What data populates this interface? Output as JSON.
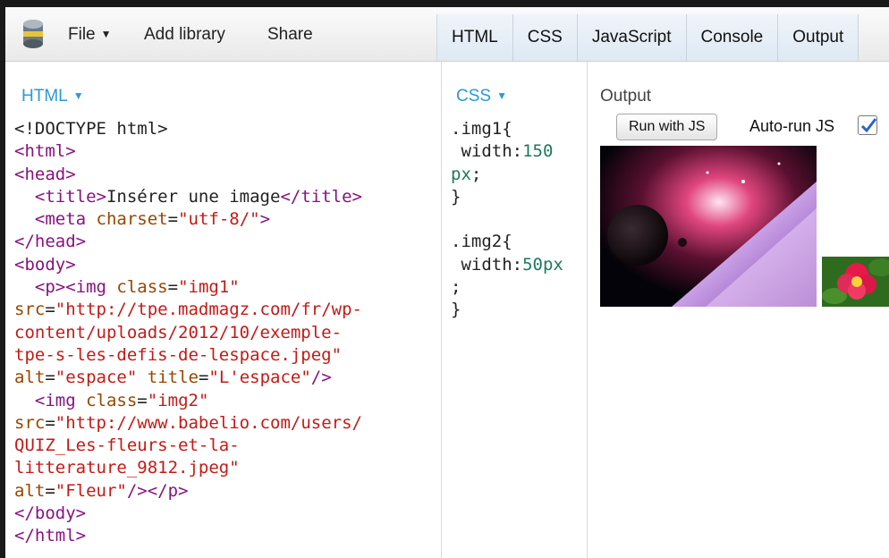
{
  "toolbar": {
    "logo_icon": "database-icon",
    "file_label": "File",
    "add_library_label": "Add library",
    "share_label": "Share",
    "tabs": [
      "HTML",
      "CSS",
      "JavaScript",
      "Console",
      "Output"
    ]
  },
  "html_panel": {
    "title": "HTML",
    "lines": [
      [
        [
          "p",
          "<!DOCTYPE html>"
        ]
      ],
      [
        [
          "t",
          "<html>"
        ]
      ],
      [
        [
          "t",
          "<head>"
        ]
      ],
      [
        [
          "p",
          "  "
        ],
        [
          "t",
          "<title>"
        ],
        [
          "p",
          "Insérer une image"
        ],
        [
          "t",
          "</title>"
        ]
      ],
      [
        [
          "p",
          "  "
        ],
        [
          "t",
          "<meta "
        ],
        [
          "a",
          "charset"
        ],
        [
          "p",
          "="
        ],
        [
          "v",
          "\"utf-8/\""
        ],
        [
          "t",
          ">"
        ]
      ],
      [
        [
          "t",
          "</head>"
        ]
      ],
      [
        [
          "t",
          "<body>"
        ]
      ],
      [
        [
          "p",
          "  "
        ],
        [
          "t",
          "<p><img "
        ],
        [
          "a",
          "class"
        ],
        [
          "p",
          "="
        ],
        [
          "v",
          "\"img1\""
        ]
      ],
      [
        [
          "a",
          "src"
        ],
        [
          "p",
          "="
        ],
        [
          "v",
          "\"http://tpe.madmagz.com/fr/wp-"
        ]
      ],
      [
        [
          "v",
          "content/uploads/2012/10/exemple-"
        ]
      ],
      [
        [
          "v",
          "tpe-s-les-defis-de-lespace.jpeg\""
        ]
      ],
      [
        [
          "a",
          "alt"
        ],
        [
          "p",
          "="
        ],
        [
          "v",
          "\"espace\""
        ],
        [
          "p",
          " "
        ],
        [
          "a",
          "title"
        ],
        [
          "p",
          "="
        ],
        [
          "v",
          "\"L'espace\""
        ],
        [
          "t",
          "/>"
        ]
      ],
      [
        [
          "p",
          "  "
        ],
        [
          "t",
          "<img "
        ],
        [
          "a",
          "class"
        ],
        [
          "p",
          "="
        ],
        [
          "v",
          "\"img2\""
        ]
      ],
      [
        [
          "a",
          "src"
        ],
        [
          "p",
          "="
        ],
        [
          "v",
          "\"http://www.babelio.com/users/"
        ]
      ],
      [
        [
          "v",
          "QUIZ_Les-fleurs-et-la-"
        ]
      ],
      [
        [
          "v",
          "litterature_9812.jpeg\""
        ]
      ],
      [
        [
          "a",
          "alt"
        ],
        [
          "p",
          "="
        ],
        [
          "v",
          "\"Fleur\""
        ],
        [
          "t",
          "/></p>"
        ]
      ],
      [
        [
          "t",
          "</body>"
        ]
      ],
      [
        [
          "t",
          "</html>"
        ]
      ]
    ]
  },
  "css_panel": {
    "title": "CSS",
    "lines": [
      [
        [
          "p",
          ".img1{"
        ]
      ],
      [
        [
          "p",
          " width:"
        ],
        [
          "n",
          "150"
        ]
      ],
      [
        [
          "n",
          "px"
        ],
        [
          "p",
          ";"
        ]
      ],
      [
        [
          "p",
          "}"
        ]
      ],
      [
        [
          "p",
          ""
        ]
      ],
      [
        [
          "p",
          ".img2{"
        ]
      ],
      [
        [
          "p",
          " width:"
        ],
        [
          "n",
          "50px"
        ]
      ],
      [
        [
          "p",
          ";"
        ]
      ],
      [
        [
          "p",
          "}"
        ]
      ]
    ]
  },
  "output_panel": {
    "title": "Output",
    "run_button_label": "Run with JS",
    "autorun_label": "Auto-run JS",
    "autorun_checked": true
  },
  "colors": {
    "accent_blue": "#2a9ad8",
    "tag": "#881280",
    "attribute": "#994500",
    "string": "#c41a16",
    "number": "#1c7a5a"
  }
}
